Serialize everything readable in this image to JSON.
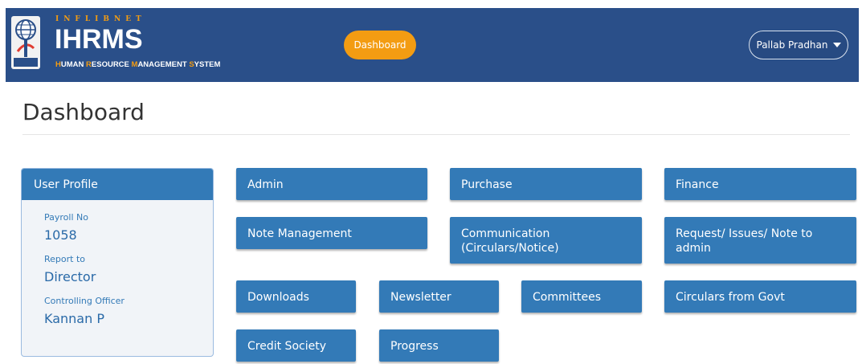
{
  "header": {
    "brand_top": "INFLIBNET",
    "brand_main": "IHRMS",
    "brand_sub": [
      {
        "hl": "H",
        "rest": "UMAN "
      },
      {
        "hl": "R",
        "rest": "ESOURCE "
      },
      {
        "hl": "M",
        "rest": "ANAGEMENT "
      },
      {
        "hl": "S",
        "rest": "YSTEM"
      }
    ],
    "logo_caption": "INFLIBNET",
    "nav_dashboard": "Dashboard",
    "user_name": "Pallab Pradhan"
  },
  "page_title": "Dashboard",
  "profile": {
    "title": "User Profile",
    "payroll_label": "Payroll No",
    "payroll_value": "1058",
    "report_label": "Report to",
    "report_value": "Director",
    "officer_label": "Controlling Officer",
    "officer_value": "Kannan P"
  },
  "tiles": {
    "admin": "Admin",
    "purchase": "Purchase",
    "finance": "Finance",
    "note_management": "Note Management",
    "communication_1": "Communication",
    "communication_2": "(Circulars/Notice)",
    "request_1": "Request/ Issues/ Note to",
    "request_2": "admin",
    "downloads": "Downloads",
    "newsletter": "Newsletter",
    "committees": "Committees",
    "circulars_govt": "Circulars from Govt",
    "credit_society": "Credit Society",
    "progress": "Progress"
  },
  "colors": {
    "navbar": "#2a4f89",
    "accent": "#f39c12",
    "tile": "#337ab7"
  }
}
